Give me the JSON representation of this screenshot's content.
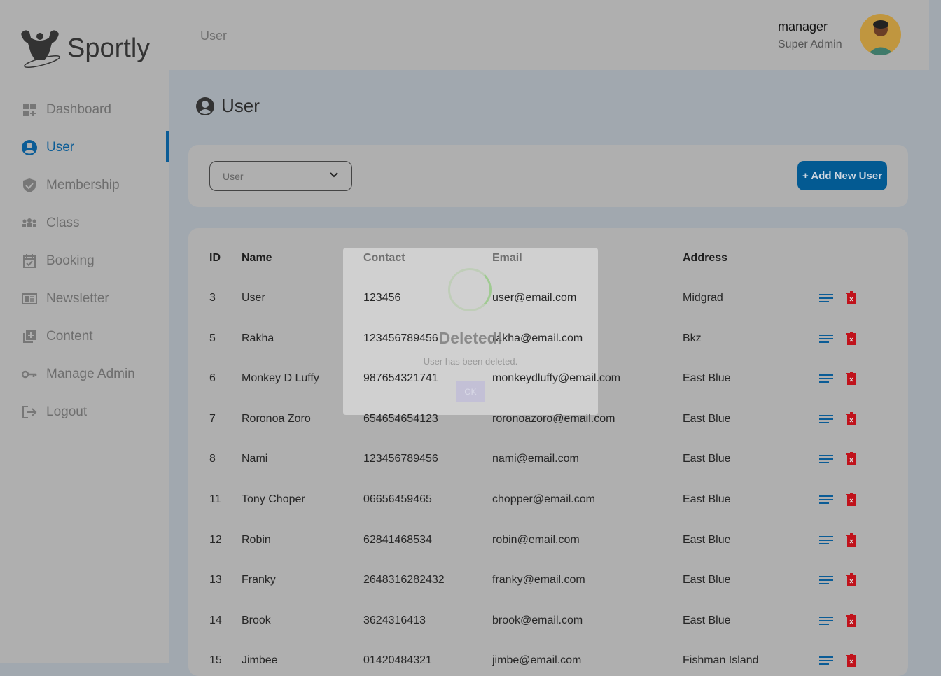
{
  "brand": {
    "name": "Sportly"
  },
  "sidebar": {
    "items": [
      {
        "label": "Dashboard",
        "icon": "dashboard-icon"
      },
      {
        "label": "User",
        "icon": "user-circle-icon",
        "active": true
      },
      {
        "label": "Membership",
        "icon": "shield-check-icon"
      },
      {
        "label": "Class",
        "icon": "group-icon"
      },
      {
        "label": "Booking",
        "icon": "calendar-check-icon"
      },
      {
        "label": "Newsletter",
        "icon": "newspaper-icon"
      },
      {
        "label": "Content",
        "icon": "add-box-icon"
      },
      {
        "label": "Manage Admin",
        "icon": "key-icon"
      },
      {
        "label": "Logout",
        "icon": "logout-icon"
      }
    ]
  },
  "header": {
    "breadcrumb": "User",
    "user_name": "manager",
    "user_role": "Super Admin"
  },
  "main": {
    "title": "User",
    "filter_value": "User",
    "add_button": "+ Add New User"
  },
  "table": {
    "columns": [
      "ID",
      "Name",
      "Contact",
      "Email",
      "Address"
    ],
    "rows": [
      [
        "3",
        "User",
        "123456",
        "user@email.com",
        "Midgrad"
      ],
      [
        "5",
        "Rakha",
        "123456789456",
        "rakha@email.com",
        "Bkz"
      ],
      [
        "6",
        "Monkey D Luffy",
        "987654321741",
        "monkeydluffy@email.com",
        "East Blue"
      ],
      [
        "7",
        "Roronoa Zoro",
        "654654654123",
        "roronoazoro@email.com",
        "East Blue"
      ],
      [
        "8",
        "Nami",
        "123456789456",
        "nami@email.com",
        "East Blue"
      ],
      [
        "11",
        "Tony Choper",
        "06656459465",
        "chopper@email.com",
        "East Blue"
      ],
      [
        "12",
        "Robin",
        "62841468534",
        "robin@email.com",
        "East Blue"
      ],
      [
        "13",
        "Franky",
        "2648316282432",
        "franky@email.com",
        "East Blue"
      ],
      [
        "14",
        "Brook",
        "3624316413",
        "brook@email.com",
        "East Blue"
      ],
      [
        "15",
        "Jimbee",
        "01420484321",
        "jimbe@email.com",
        "Fishman Island"
      ]
    ]
  },
  "modal": {
    "title": "Deleted!",
    "message": "User has been deleted.",
    "ok_label": "OK"
  },
  "colors": {
    "accent": "#0b5c96",
    "danger": "#c0121b"
  }
}
